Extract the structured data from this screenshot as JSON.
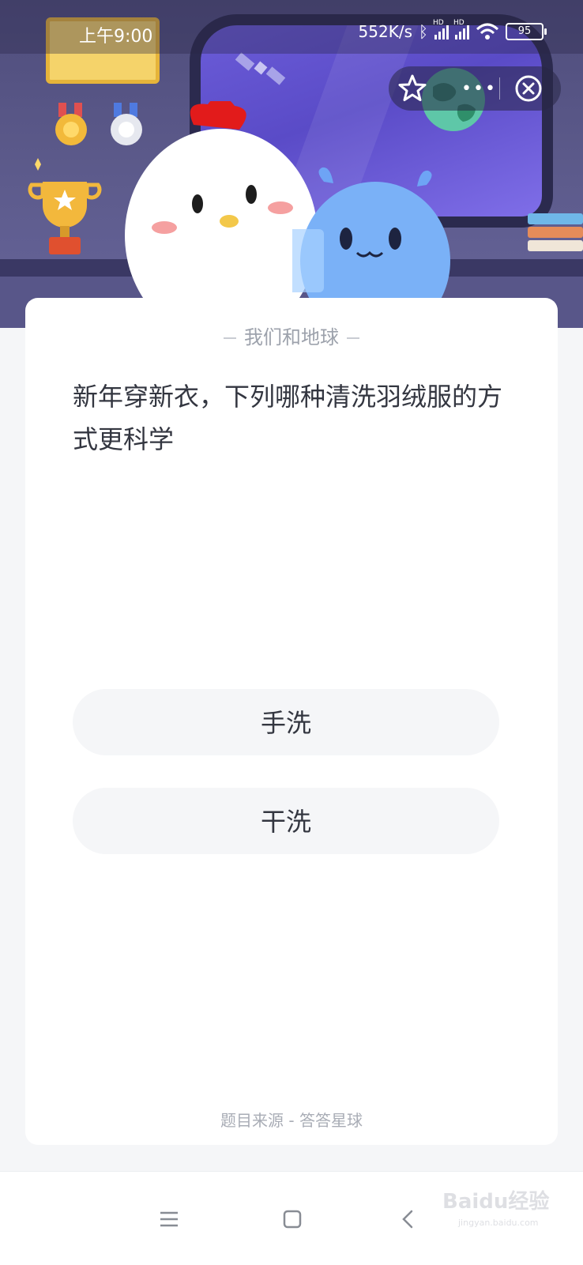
{
  "status_bar": {
    "time": "上午9:00",
    "net_speed": "552K/s",
    "signal_label_1": "HD",
    "signal_label_2": "HD",
    "battery": "95"
  },
  "miniapp_capsule": {
    "favorite_icon": "star-icon",
    "more_icon": "more-dots-icon",
    "more_label": "•••",
    "close_icon": "close-circle-icon"
  },
  "quiz": {
    "category": "我们和地球",
    "question": "新年穿新衣，下列哪种清洗羽绒服的方式更科学",
    "options": [
      {
        "label": "手洗"
      },
      {
        "label": "干洗"
      }
    ],
    "source": "题目来源 - 答答星球"
  },
  "nav_bar": {
    "menu_icon": "menu-icon",
    "home_icon": "home-square-icon",
    "back_icon": "back-chevron-icon"
  },
  "watermark": {
    "brand": "Baidu经验",
    "url": "jingyan.baidu.com"
  },
  "colors": {
    "scene_bg": "#5d5b8c",
    "card_bg": "#ffffff",
    "page_bg": "#f5f6f8",
    "option_bg": "#f5f6f8",
    "question_text": "#333640",
    "muted_text": "#9da2ac"
  }
}
